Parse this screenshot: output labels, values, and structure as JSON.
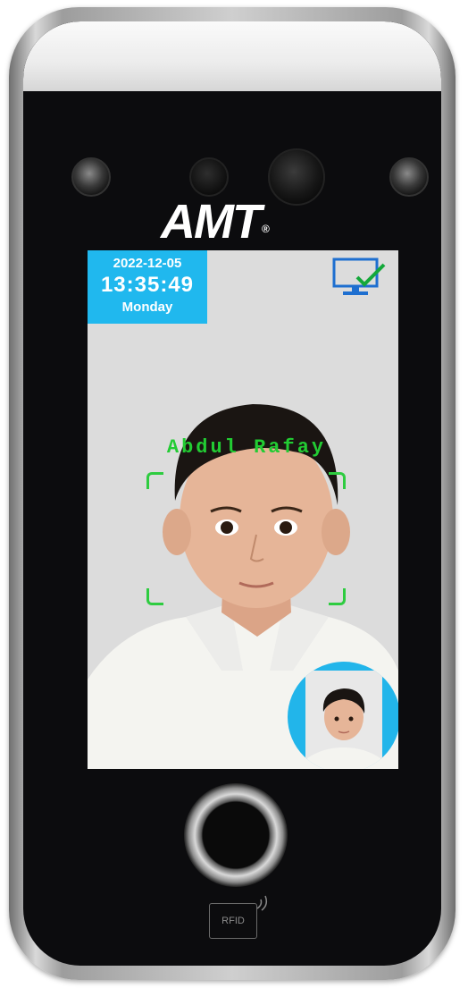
{
  "device": {
    "brand": "AMT",
    "registered_mark": "®",
    "rfid_label": "RFID"
  },
  "screen": {
    "date": "2022-12-05",
    "time": "13:35:49",
    "day": "Monday",
    "recognized_name": "Abdul Rafay",
    "status_icon": "monitor-check-icon"
  },
  "colors": {
    "date_panel": "#20b8ee",
    "name_text": "#22cc33",
    "face_frame": "#2ecc40",
    "screen_background": "#dcdcdc"
  }
}
